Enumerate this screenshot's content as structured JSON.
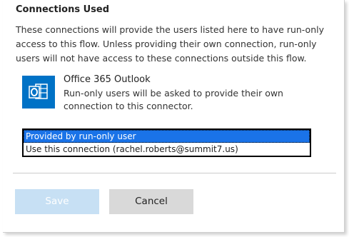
{
  "section": {
    "title": "Connections Used",
    "description": "These connections will provide the users listed here to have run-only access to this flow. Unless providing their own connection, run-only users will not have access to these connections outside this flow."
  },
  "connector": {
    "name": "Office 365 Outlook",
    "description": "Run-only users will be asked to provide their own connection to this connector.",
    "icon": "outlook-icon",
    "icon_color": "#0072c6"
  },
  "connection_options": [
    {
      "label": "Provided by run-only user",
      "selected": true
    },
    {
      "label": "Use this connection (rachel.roberts@summit7.us)",
      "selected": false
    }
  ],
  "buttons": {
    "save_label": "Save",
    "cancel_label": "Cancel"
  },
  "colors": {
    "selection": "#1a73e8",
    "save_disabled_bg": "#c7e0f4",
    "cancel_bg": "#d9d9d9"
  }
}
